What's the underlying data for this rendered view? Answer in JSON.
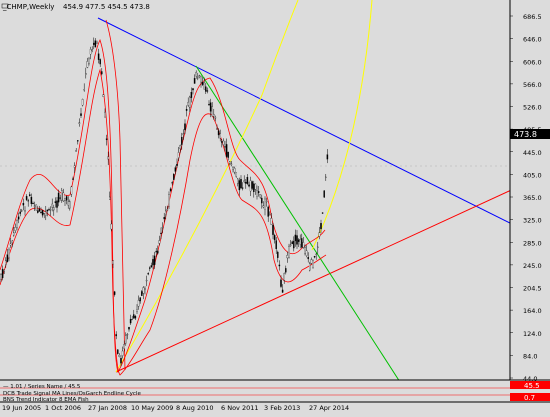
{
  "header": {
    "symbol": "_CHMP,Weekly",
    "ohlc": "454.9 477.5 454.5 473.8"
  },
  "price_scale": {
    "labels": [
      "686.5",
      "646.0",
      "606.0",
      "566.0",
      "526.0",
      "485.5",
      "445.0",
      "405.0",
      "365.0",
      "325.0",
      "285.0",
      "245.0",
      "204.5",
      "164.0",
      "124.0",
      "84.0",
      "44.0"
    ],
    "current_price": "473.8"
  },
  "indicator": {
    "title": "BNS Trend Indicator 8 EMA Fish",
    "values": [
      "45.5",
      "0.7"
    ],
    "legend_line1": "— 1.01 / Series Name / 45.5",
    "legend_line2": "DCB Trade Signal MA Lines/OsGarch Endline Cycle"
  },
  "time_axis": {
    "labels": [
      "19 Jun 2005",
      "1 Oct 2006",
      "27 Jan 2008",
      "10 May 2009",
      "8 Aug 2010",
      "6 Nov 2011",
      "3 Feb 2013",
      "27 Apr 2014"
    ]
  },
  "colors": {
    "background": "#dcdcdc",
    "candles": "#000000",
    "bands": "#ff0000",
    "trend_line_blue": "#0000ff",
    "trend_line_red": "#ff0000",
    "trend_line_green": "#00c000",
    "curve_yellow": "#ffff00",
    "price_marker": "#000000"
  }
}
